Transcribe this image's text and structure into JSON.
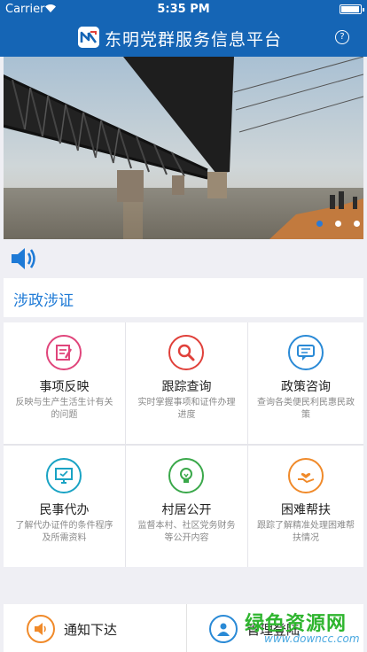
{
  "status_bar": {
    "carrier": "Carrier",
    "time": "5:35 PM"
  },
  "nav": {
    "title": "东明党群服务信息平台",
    "help_symbol": "?",
    "brand_color": "#1565b5"
  },
  "banner": {
    "slides": 3,
    "active_slide": 1
  },
  "section": {
    "title": "涉政涉证"
  },
  "grid": [
    {
      "label": "事项反映",
      "desc": "反映与生产生活生计有关的问题",
      "icon": "edit-note-icon",
      "color": "#e0457b"
    },
    {
      "label": "跟踪查询",
      "desc": "实时掌握事项和证件办理进度",
      "icon": "search-icon",
      "color": "#e0403a"
    },
    {
      "label": "政策咨询",
      "desc": "查询各类便民利民惠民政策",
      "icon": "chat-bubble-icon",
      "color": "#2a8ad6"
    },
    {
      "label": "民事代办",
      "desc": "了解代办证件的条件程序及所需资料",
      "icon": "monitor-icon",
      "color": "#1aa3c4"
    },
    {
      "label": "村居公开",
      "desc": "监督本村、社区党务财务等公开内容",
      "icon": "lightbulb-icon",
      "color": "#3aa84a"
    },
    {
      "label": "困难帮扶",
      "desc": "跟踪了解精准处理困难帮扶情况",
      "icon": "helping-hand-icon",
      "color": "#f08a2a"
    }
  ],
  "bottom": {
    "notify": {
      "label": "通知下达",
      "icon": "speaker-icon",
      "color": "#f08a2a"
    },
    "login": {
      "label": "管理登陆",
      "icon": "admin-user-icon",
      "color": "#2a8ad6"
    }
  },
  "watermark": {
    "text": "绿色资源网",
    "url": "www.downcc.com"
  }
}
